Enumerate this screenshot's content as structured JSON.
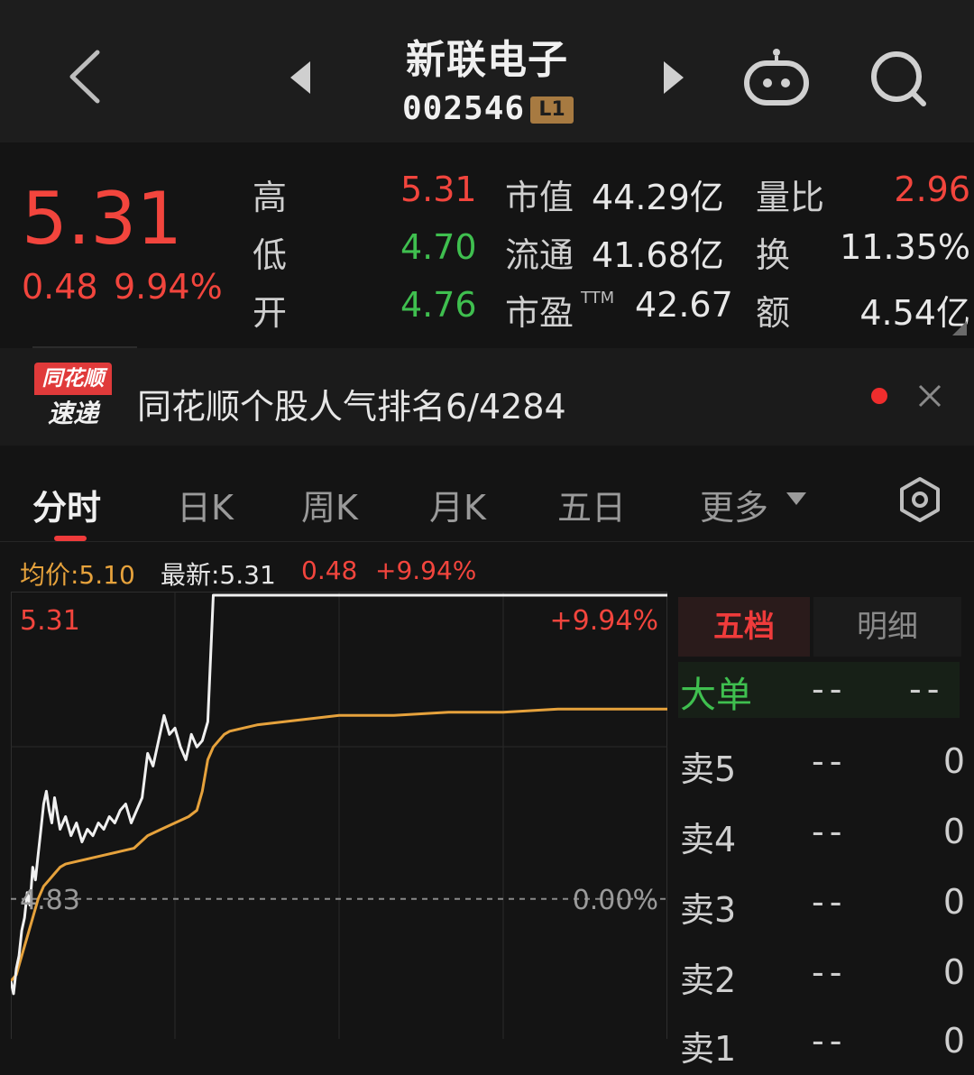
{
  "header": {
    "back_icon": "chevron-left-icon",
    "prev_icon": "triangle-left-icon",
    "next_icon": "triangle-right-icon",
    "robot_icon": "robot-icon",
    "search_icon": "search-icon",
    "title": "新联电子",
    "code": "002546",
    "level": "L1"
  },
  "quote": {
    "price": "5.31",
    "change": "0.48",
    "change_pct": "9.94%",
    "high_label": "高",
    "high": "5.31",
    "low_label": "低",
    "low": "4.70",
    "open_label": "开",
    "open": "4.76",
    "mktcap_label": "市值",
    "mktcap": "44.29亿",
    "float_label": "流通",
    "float": "41.68亿",
    "pe_label": "市盈",
    "pe_sup": "TTM",
    "pe": "42.67",
    "vol_ratio_label": "量比",
    "vol_ratio": "2.96",
    "turnover_label": "换",
    "turnover": "11.35%",
    "amount_label": "额",
    "amount": "4.54亿"
  },
  "news": {
    "badge_top": "同花顺",
    "badge_bottom": "速递",
    "text": "同花顺个股人气排名6/4284",
    "close_icon": "close-icon"
  },
  "tabs": {
    "items": [
      "分时",
      "日K",
      "周K",
      "月K",
      "五日",
      "更多"
    ],
    "more_icon": "caret-down-icon",
    "settings_icon": "hexagon-settings-icon"
  },
  "infoline": {
    "avg": "均价:5.10",
    "latest": "最新:5.31",
    "change": "0.48",
    "change_pct": "+9.94%"
  },
  "chart_data": {
    "type": "line",
    "y_top_label": "5.31",
    "y_top_pct": "+9.94%",
    "y_base_label": "4.83",
    "y_base_pct": "0.00%",
    "ylim": [
      4.62,
      5.31
    ],
    "xlim": [
      0,
      240
    ],
    "series": [
      {
        "color": "#f0f0f0",
        "x": [
          0,
          1,
          2,
          3,
          4,
          5,
          6,
          7,
          8,
          9,
          10,
          11,
          12,
          13,
          14,
          15,
          16,
          18,
          20,
          22,
          24,
          26,
          28,
          30,
          32,
          34,
          36,
          38,
          40,
          42,
          44,
          46,
          48,
          50,
          52,
          54,
          56,
          58,
          60,
          62,
          64,
          66,
          68,
          70,
          72,
          74,
          76,
          78,
          80,
          82,
          84,
          86,
          88,
          90,
          92,
          94,
          96,
          97,
          98,
          99,
          100,
          101,
          102,
          104,
          106,
          108,
          110,
          112,
          114,
          116,
          118,
          120,
          130,
          140,
          160,
          180,
          200,
          220,
          240
        ],
        "values": [
          4.7,
          4.68,
          4.72,
          4.74,
          4.78,
          4.8,
          4.84,
          4.82,
          4.88,
          4.86,
          4.9,
          4.94,
          4.98,
          5.0,
          4.97,
          4.95,
          4.99,
          4.94,
          4.96,
          4.93,
          4.95,
          4.92,
          4.94,
          4.93,
          4.95,
          4.94,
          4.96,
          4.95,
          4.97,
          4.98,
          4.95,
          4.97,
          4.99,
          5.06,
          5.04,
          5.08,
          5.12,
          5.09,
          5.1,
          5.07,
          5.05,
          5.09,
          5.07,
          5.08,
          5.11,
          5.31,
          5.31,
          5.31,
          5.31,
          5.31,
          5.31,
          5.31,
          5.31,
          5.31,
          5.31,
          5.31,
          5.31,
          5.31,
          5.31,
          5.31,
          5.31,
          5.31,
          5.31,
          5.31,
          5.31,
          5.31,
          5.31,
          5.31,
          5.31,
          5.31,
          5.31,
          5.31,
          5.31,
          5.31,
          5.31,
          5.31,
          5.31,
          5.31,
          5.31
        ]
      },
      {
        "color": "#e6a23c",
        "x": [
          0,
          2,
          4,
          6,
          8,
          10,
          12,
          14,
          16,
          18,
          20,
          25,
          30,
          35,
          40,
          45,
          50,
          55,
          60,
          65,
          68,
          70,
          72,
          74,
          76,
          78,
          80,
          85,
          90,
          100,
          110,
          120,
          140,
          160,
          180,
          200,
          220,
          240
        ],
        "values": [
          4.7,
          4.71,
          4.74,
          4.77,
          4.8,
          4.83,
          4.85,
          4.86,
          4.87,
          4.88,
          4.885,
          4.89,
          4.895,
          4.9,
          4.905,
          4.91,
          4.93,
          4.94,
          4.95,
          4.96,
          4.97,
          5.0,
          5.05,
          5.07,
          5.08,
          5.09,
          5.095,
          5.1,
          5.105,
          5.11,
          5.115,
          5.12,
          5.12,
          5.125,
          5.125,
          5.13,
          5.13,
          5.13
        ]
      }
    ]
  },
  "book": {
    "tab_active": "五档",
    "tab_other": "明细",
    "big_label": "大单",
    "big_mid": "--",
    "big_val": "--",
    "rows": [
      {
        "label": "卖5",
        "price": "--",
        "vol": "0"
      },
      {
        "label": "卖4",
        "price": "--",
        "vol": "0"
      },
      {
        "label": "卖3",
        "price": "--",
        "vol": "0"
      },
      {
        "label": "卖2",
        "price": "--",
        "vol": "0"
      },
      {
        "label": "卖1",
        "price": "--",
        "vol": "0"
      }
    ]
  }
}
